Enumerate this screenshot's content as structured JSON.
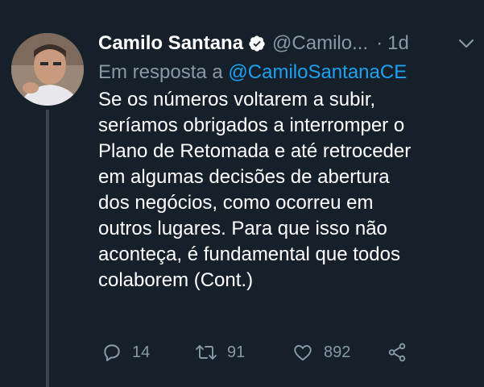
{
  "tweet": {
    "author_name": "Camilo Santana",
    "handle": "@Camilo...",
    "separator": "·",
    "time": "1d",
    "reply_prefix": "Em resposta a",
    "reply_mention": "@CamiloSantanaCE",
    "body_lines": [
      "Se os números voltarem a subir,",
      "seríamos obrigados a interromper o",
      "Plano de Retomada e até retroceder",
      "em algumas decisões de abertura",
      "dos negócios, como ocorreu em",
      "outros lugares. Para que isso não",
      "aconteça, é fundamental que todos",
      "colaborem (Cont.)"
    ],
    "replies": "14",
    "retweets": "91",
    "likes": "892"
  },
  "icons": {
    "verified": "verified-badge-icon",
    "chevron": "chevron-down-icon",
    "reply": "reply-icon",
    "retweet": "retweet-icon",
    "like": "heart-icon",
    "share": "share-icon"
  },
  "colors": {
    "background": "#15202b",
    "secondary_text": "#8899a6",
    "link": "#1da1f2",
    "thread_line": "#38444d"
  }
}
